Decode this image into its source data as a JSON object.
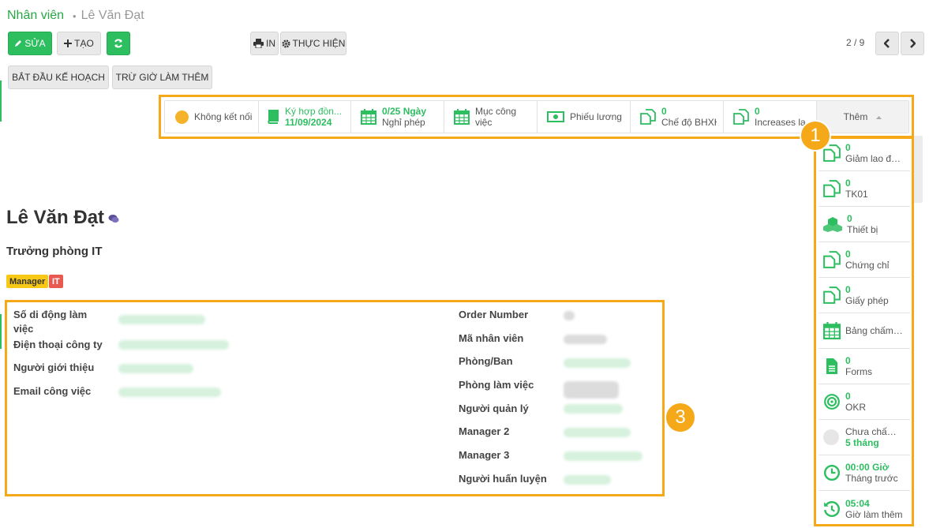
{
  "breadcrumb": {
    "parent": "Nhân viên",
    "current": "Lê Văn Đạt"
  },
  "toolbar": {
    "edit_label": "SỬA",
    "create_label": "TẠO",
    "print_label": "IN",
    "action_label": "THỰC HIỆN",
    "pager": "2 / 9",
    "plan_label": "BẮT ĐẦU KẾ HOẠCH",
    "overtime_label": "TRỪ GIỜ LÀM THÊM"
  },
  "stats": [
    {
      "icon": "status-dot-icon",
      "num": "",
      "label": "Không kết nối"
    },
    {
      "icon": "book-icon",
      "num": "Ký hợp đồn...",
      "label": "11/09/2024"
    },
    {
      "icon": "calendar-icon",
      "num": "0/25 Ngày",
      "label": "Nghỉ phép"
    },
    {
      "icon": "calendar-icon",
      "num": "",
      "label": "Mục công",
      "label2": "việc"
    },
    {
      "icon": "money-icon",
      "num": "",
      "label": "Phiếu lương"
    },
    {
      "icon": "copy-icon",
      "num": "0",
      "label": "Chế độ BHXH"
    },
    {
      "icon": "copy-icon",
      "num": "0",
      "label": "Increases la..."
    },
    {
      "icon": "caret-up-icon",
      "num": "",
      "label": "Thêm"
    }
  ],
  "side_items": [
    {
      "icon": "copy-icon",
      "num": "0",
      "label": "Giảm lao độ..."
    },
    {
      "icon": "copy-icon",
      "num": "0",
      "label": "TK01"
    },
    {
      "icon": "cubes-icon",
      "num": "0",
      "label": "Thiết bị"
    },
    {
      "icon": "copy-icon",
      "num": "0",
      "label": "Chứng chỉ"
    },
    {
      "icon": "copy-icon",
      "num": "0",
      "label": "Giấy phép"
    },
    {
      "icon": "calendar-icon",
      "num": "",
      "label": "Bảng chấm ..."
    },
    {
      "icon": "file-icon",
      "num": "0",
      "label": "Forms"
    },
    {
      "icon": "target-icon",
      "num": "0",
      "label": "OKR"
    },
    {
      "icon": "grey-dot-icon",
      "num": "5 tháng",
      "label": "Chưa chấm ..."
    },
    {
      "icon": "clock-icon",
      "num": "00:00 Giờ",
      "label": "Tháng trước"
    },
    {
      "icon": "history-icon",
      "num": "05:04",
      "label": "Giờ làm thêm"
    }
  ],
  "markers": {
    "m1": "1",
    "m3": "3"
  },
  "employee": {
    "name": "Lê Văn Đạt",
    "job_title": "Trưởng phòng IT",
    "tags": [
      "Manager",
      "IT"
    ]
  },
  "fields_left": [
    {
      "label": "Số di động làm",
      "label2": "việc"
    },
    {
      "label": "Điện thoại công ty"
    },
    {
      "label": "Người giới thiệu"
    },
    {
      "label": "Email công việc"
    }
  ],
  "fields_right": [
    "Order Number",
    "Mã nhân viên",
    "Phòng/Ban",
    "Phòng làm việc",
    "Người quản lý",
    "Manager 2",
    "Manager 3",
    "Người huấn luyện"
  ],
  "colors": {
    "accent": "#2dbe60",
    "highlight": "#f5a818",
    "tag_manager": "#f7c815",
    "tag_it": "#e85a4f"
  }
}
